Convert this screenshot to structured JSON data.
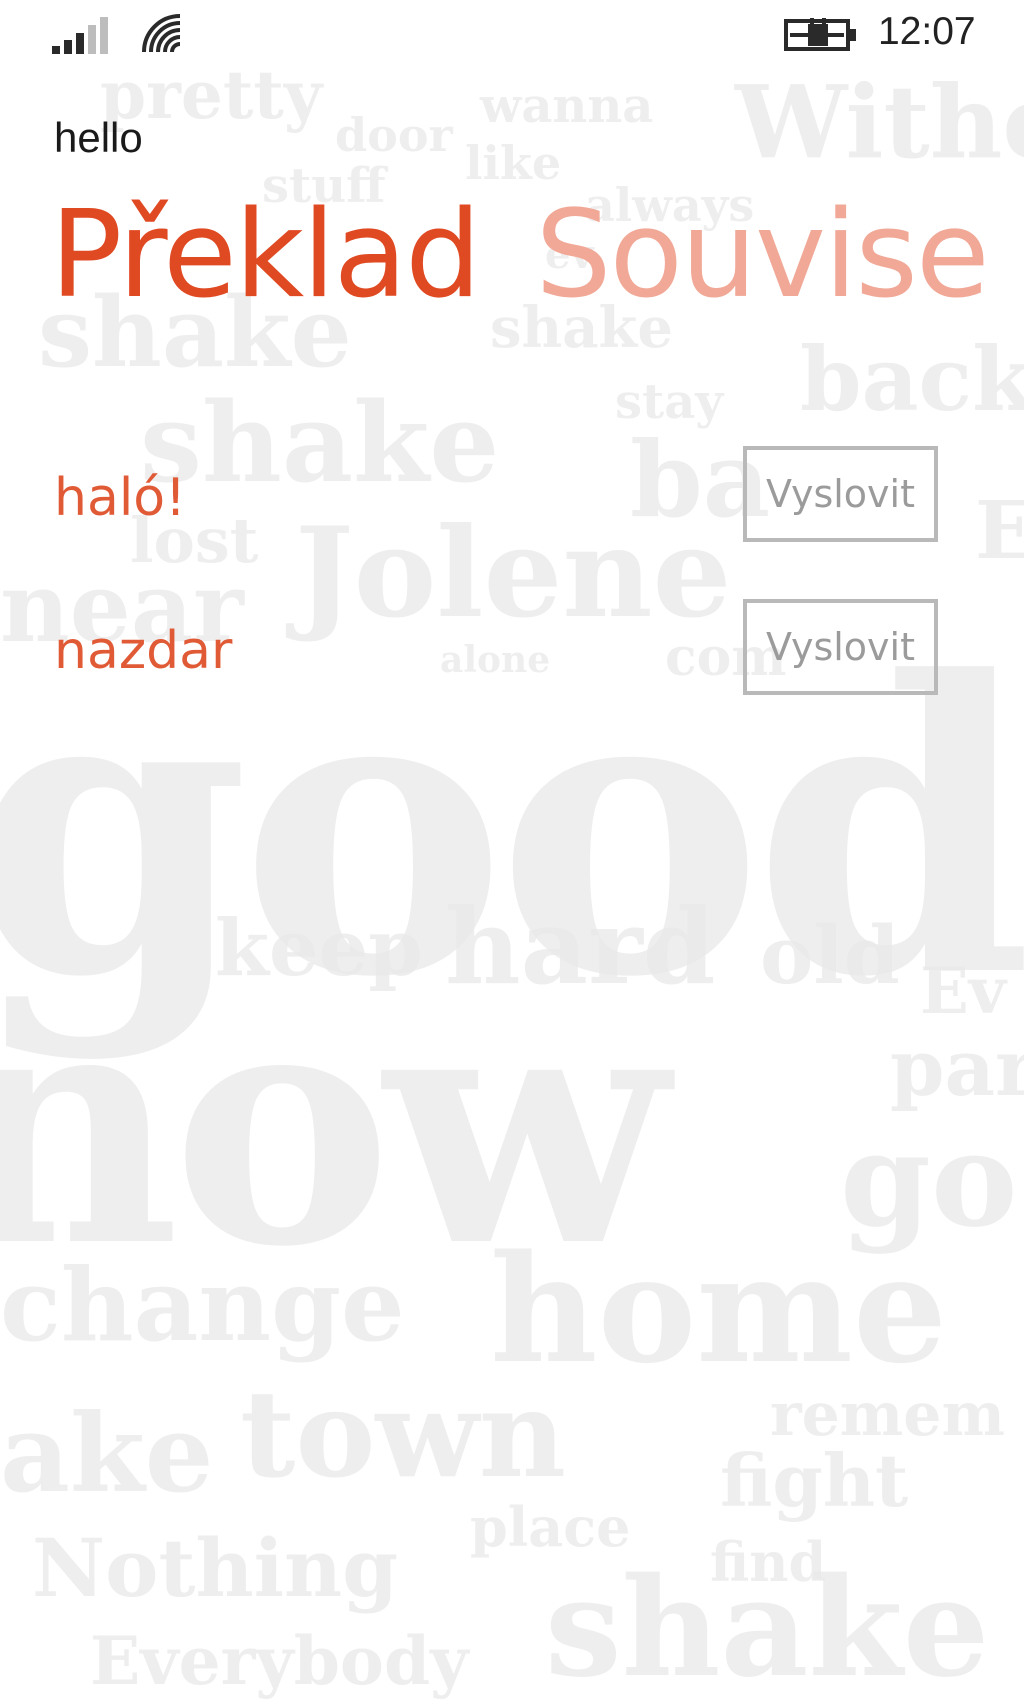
{
  "status_bar": {
    "time": "12:07",
    "signal_icon": "signal-strength-icon",
    "wifi_icon": "wifi-icon",
    "battery_icon": "battery-charging-icon"
  },
  "app": {
    "title": "hello"
  },
  "pivot": {
    "items": [
      {
        "label": "Překlad",
        "active": true
      },
      {
        "label": "Souvise",
        "active": false
      }
    ]
  },
  "translations": [
    {
      "word": "haló!",
      "speak_label": "Vyslovit"
    },
    {
      "word": "nazdar",
      "speak_label": "Vyslovit"
    }
  ],
  "background_words": [
    "pretty",
    "wanna",
    "Withe",
    "door",
    "like",
    "stuff",
    "always",
    "ev",
    "shake",
    "shake",
    "back",
    "stay",
    "shake",
    "ba",
    "E",
    "lost",
    "Jolene",
    "near",
    "alone",
    "com",
    "good",
    "keep",
    "hard",
    "old",
    "Ev",
    "par",
    "now",
    "go",
    "change",
    "home",
    "ake",
    "town",
    "remem",
    "fight",
    "place",
    "find",
    "Nothing",
    "shake",
    "Everybody"
  ],
  "colors": {
    "accent": "#e04a23",
    "accent_light": "#f1a896",
    "translation_text": "#e05a36",
    "button_border": "#b9b9b9",
    "button_text": "#9b9b9b",
    "background_words": "#e9e9e9"
  }
}
